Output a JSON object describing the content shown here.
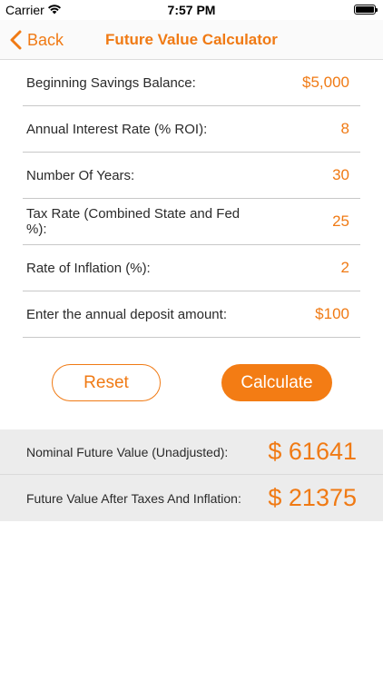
{
  "status_bar": {
    "carrier": "Carrier",
    "time": "7:57 PM"
  },
  "nav": {
    "back_label": "Back",
    "title": "Future Value Calculator"
  },
  "form": {
    "rows": [
      {
        "label": "Beginning Savings Balance:",
        "value": "$5,000"
      },
      {
        "label": "Annual Interest Rate (% ROI):",
        "value": "8"
      },
      {
        "label": "Number Of Years:",
        "value": "30"
      },
      {
        "label": "Tax Rate (Combined State and Fed %):",
        "value": "25"
      },
      {
        "label": "Rate of Inflation (%):",
        "value": "2"
      },
      {
        "label": "Enter the annual deposit amount:",
        "value": "$100"
      }
    ]
  },
  "actions": {
    "reset_label": "Reset",
    "calculate_label": "Calculate"
  },
  "results": {
    "nominal_label": "Nominal Future Value (Unadjusted):",
    "nominal_value": "$ 61641",
    "adjusted_label": "Future Value After Taxes And Inflation:",
    "adjusted_value": "$ 21375"
  },
  "colors": {
    "accent": "#f07a14",
    "results_background": "#ececec"
  }
}
